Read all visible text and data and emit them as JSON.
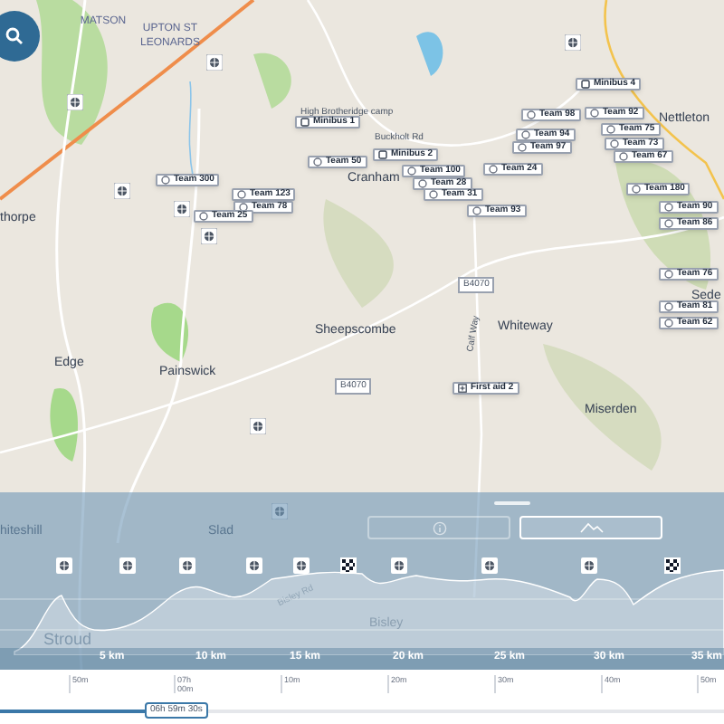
{
  "map": {
    "places": [
      {
        "name": "MATSON",
        "kind": "district"
      },
      {
        "name": "UPTON ST LEONARDS",
        "kind": "district"
      },
      {
        "name": "High Brotheridge camp",
        "kind": "site"
      },
      {
        "name": "Buckholt Rd",
        "kind": "road"
      },
      {
        "name": "Cranham",
        "kind": "village"
      },
      {
        "name": "Nettleton",
        "kind": "village"
      },
      {
        "name": "thorpe",
        "kind": "village"
      },
      {
        "name": "Sheepscombe",
        "kind": "village"
      },
      {
        "name": "B4070",
        "kind": "road_number"
      },
      {
        "name": "B4070",
        "kind": "road_number"
      },
      {
        "name": "Whiteway",
        "kind": "village"
      },
      {
        "name": "Calf Way",
        "kind": "road"
      },
      {
        "name": "Edge",
        "kind": "village"
      },
      {
        "name": "Painswick",
        "kind": "village"
      },
      {
        "name": "Miserden",
        "kind": "village"
      },
      {
        "name": "Sede",
        "kind": "village"
      },
      {
        "name": "hiteshill",
        "kind": "village"
      },
      {
        "name": "Slad",
        "kind": "village"
      },
      {
        "name": "Bisley Rd",
        "kind": "road"
      },
      {
        "name": "Bisley",
        "kind": "village"
      },
      {
        "name": "Stroud",
        "kind": "town"
      }
    ],
    "markers": [
      {
        "label": "Minibus 1",
        "kind": "minibus"
      },
      {
        "label": "Team 50",
        "kind": "team"
      },
      {
        "label": "Team 300",
        "kind": "team"
      },
      {
        "label": "Team 123",
        "kind": "team"
      },
      {
        "label": "Team 78",
        "kind": "team"
      },
      {
        "label": "Team 25",
        "kind": "team"
      },
      {
        "label": "Minibus 2",
        "kind": "minibus"
      },
      {
        "label": "Team 100",
        "kind": "team"
      },
      {
        "label": "Team 28",
        "kind": "team"
      },
      {
        "label": "Team 31",
        "kind": "team"
      },
      {
        "label": "Team 24",
        "kind": "team"
      },
      {
        "label": "Team 93",
        "kind": "team"
      },
      {
        "label": "Team 98",
        "kind": "team"
      },
      {
        "label": "Team 94",
        "kind": "team"
      },
      {
        "label": "Team 97",
        "kind": "team"
      },
      {
        "label": "Minibus 4",
        "kind": "minibus"
      },
      {
        "label": "Team 92",
        "kind": "team"
      },
      {
        "label": "Team 75",
        "kind": "team"
      },
      {
        "label": "Team 73",
        "kind": "team"
      },
      {
        "label": "Team 67",
        "kind": "team"
      },
      {
        "label": "Team 180",
        "kind": "team"
      },
      {
        "label": "Team 90",
        "kind": "team"
      },
      {
        "label": "Team 86",
        "kind": "team"
      },
      {
        "label": "Team 76",
        "kind": "team"
      },
      {
        "label": "Team 81",
        "kind": "team"
      },
      {
        "label": "Team 62",
        "kind": "team"
      },
      {
        "label": "First aid 2",
        "kind": "first_aid"
      }
    ]
  },
  "elevation_panel": {
    "tabs": [
      {
        "kind": "info",
        "selected": false
      },
      {
        "kind": "profile",
        "selected": true
      }
    ],
    "distance_labels": [
      "5 km",
      "10 km",
      "15 km",
      "20 km",
      "25 km",
      "30 km",
      "35 km"
    ]
  },
  "timeline": {
    "tick_labels": [
      "50m",
      "07h 00m",
      "10m",
      "20m",
      "30m",
      "40m",
      "50m"
    ],
    "current_time": "06h 59m 30s",
    "level": 0.22
  }
}
